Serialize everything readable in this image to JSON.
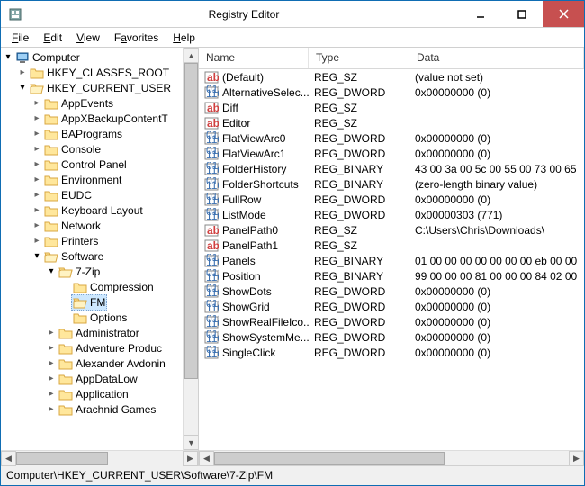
{
  "window": {
    "title": "Registry Editor"
  },
  "menu": {
    "file": "File",
    "edit": "Edit",
    "view": "View",
    "favorites": "Favorites",
    "help": "Help"
  },
  "tree": {
    "root": "Computer",
    "hkcr": "HKEY_CLASSES_ROOT",
    "hkcu": "HKEY_CURRENT_USER",
    "items": [
      "AppEvents",
      "AppXBackupContentT",
      "BAPrograms",
      "Console",
      "Control Panel",
      "Environment",
      "EUDC",
      "Keyboard Layout",
      "Network",
      "Printers",
      "Software"
    ],
    "sw_children": {
      "sevenzip": "7-Zip",
      "sevenzip_children": [
        "Compression",
        "FM",
        "Options"
      ],
      "rest": [
        "Administrator",
        "Adventure Produc",
        "Alexander Avdonin",
        "AppDataLow",
        "Application",
        "Arachnid Games"
      ]
    }
  },
  "list": {
    "cols": {
      "name": "Name",
      "type": "Type",
      "data": "Data"
    },
    "rows": [
      {
        "icon": "sz",
        "name": "(Default)",
        "type": "REG_SZ",
        "data": "(value not set)"
      },
      {
        "icon": "bin",
        "name": "AlternativeSelec...",
        "type": "REG_DWORD",
        "data": "0x00000000 (0)"
      },
      {
        "icon": "sz",
        "name": "Diff",
        "type": "REG_SZ",
        "data": ""
      },
      {
        "icon": "sz",
        "name": "Editor",
        "type": "REG_SZ",
        "data": ""
      },
      {
        "icon": "bin",
        "name": "FlatViewArc0",
        "type": "REG_DWORD",
        "data": "0x00000000 (0)"
      },
      {
        "icon": "bin",
        "name": "FlatViewArc1",
        "type": "REG_DWORD",
        "data": "0x00000000 (0)"
      },
      {
        "icon": "bin",
        "name": "FolderHistory",
        "type": "REG_BINARY",
        "data": "43 00 3a 00 5c 00 55 00 73 00 65"
      },
      {
        "icon": "bin",
        "name": "FolderShortcuts",
        "type": "REG_BINARY",
        "data": "(zero-length binary value)"
      },
      {
        "icon": "bin",
        "name": "FullRow",
        "type": "REG_DWORD",
        "data": "0x00000000 (0)"
      },
      {
        "icon": "bin",
        "name": "ListMode",
        "type": "REG_DWORD",
        "data": "0x00000303 (771)"
      },
      {
        "icon": "sz",
        "name": "PanelPath0",
        "type": "REG_SZ",
        "data": "C:\\Users\\Chris\\Downloads\\"
      },
      {
        "icon": "sz",
        "name": "PanelPath1",
        "type": "REG_SZ",
        "data": ""
      },
      {
        "icon": "bin",
        "name": "Panels",
        "type": "REG_BINARY",
        "data": "01 00 00 00 00 00 00 00 eb 00 00"
      },
      {
        "icon": "bin",
        "name": "Position",
        "type": "REG_BINARY",
        "data": "99 00 00 00 81 00 00 00 84 02 00"
      },
      {
        "icon": "bin",
        "name": "ShowDots",
        "type": "REG_DWORD",
        "data": "0x00000000 (0)"
      },
      {
        "icon": "bin",
        "name": "ShowGrid",
        "type": "REG_DWORD",
        "data": "0x00000000 (0)"
      },
      {
        "icon": "bin",
        "name": "ShowRealFileIco...",
        "type": "REG_DWORD",
        "data": "0x00000000 (0)"
      },
      {
        "icon": "bin",
        "name": "ShowSystemMe...",
        "type": "REG_DWORD",
        "data": "0x00000000 (0)"
      },
      {
        "icon": "bin",
        "name": "SingleClick",
        "type": "REG_DWORD",
        "data": "0x00000000 (0)"
      }
    ]
  },
  "status": "Computer\\HKEY_CURRENT_USER\\Software\\7-Zip\\FM"
}
